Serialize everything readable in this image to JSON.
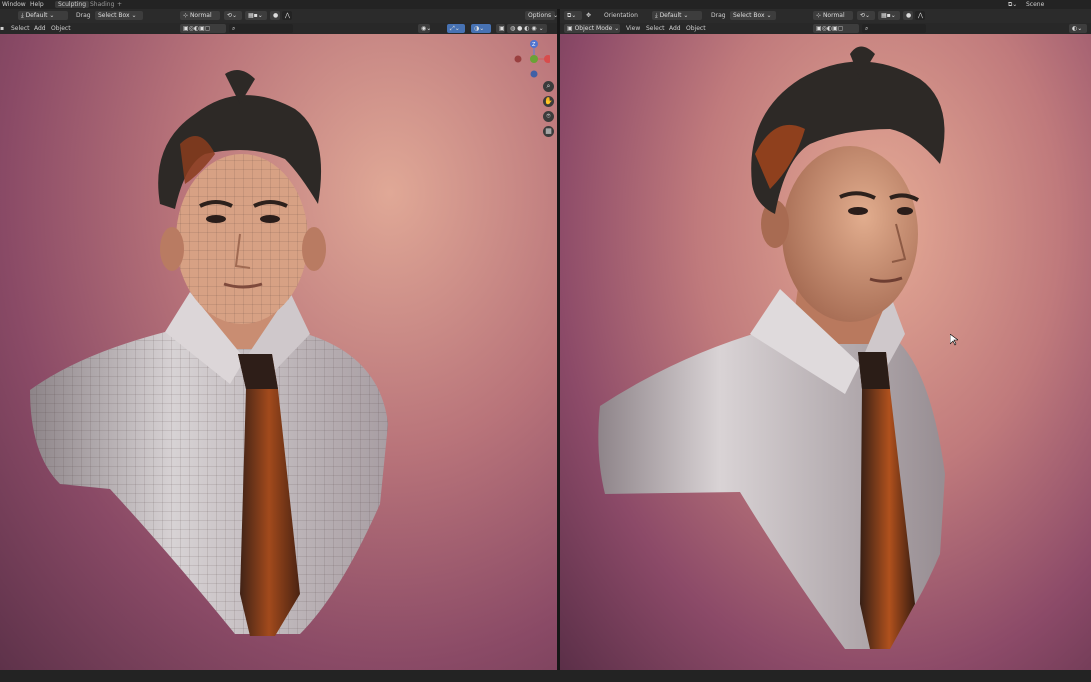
{
  "menu": {
    "window": "Window",
    "help": "Help",
    "tab_sculpting": "Sculpting",
    "tab_shading": "Shading",
    "add_tab": "+",
    "scene": "Scene"
  },
  "left": {
    "header": {
      "orientation": "Default",
      "drag": "Drag",
      "select_box": "Select Box",
      "transform": "Normal",
      "options": "Options"
    },
    "menus": {
      "select": "Select",
      "add": "Add",
      "object": "Object"
    }
  },
  "right": {
    "header": {
      "orientation_label": "Orientation",
      "orientation": "Default",
      "drag": "Drag",
      "select_box": "Select Box",
      "transform": "Normal"
    },
    "menus": {
      "mode": "Object Mode",
      "view": "View",
      "select": "Select",
      "add": "Add",
      "object": "Object"
    }
  },
  "gizmo": {
    "z": "Z",
    "x": "X",
    "y": "Y"
  },
  "colors": {
    "skin": "#d8a285",
    "shirt": "#cfc8cb",
    "tie": "#8a3f1c",
    "hair": "#2d2926",
    "accent": "#4772b3"
  }
}
